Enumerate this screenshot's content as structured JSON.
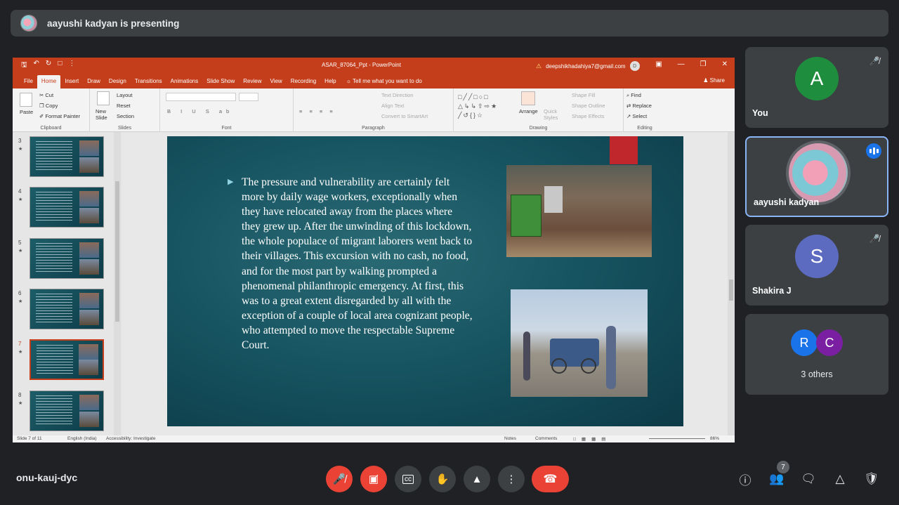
{
  "presenting_bar": {
    "text": "aayushi kadyan is presenting"
  },
  "powerpoint": {
    "window_title": "ASAR_87064_Ppt - PowerPoint",
    "account_email": "deepshikhadahiya7@gmail.com",
    "account_initial": "D",
    "tabs": [
      "File",
      "Home",
      "Insert",
      "Draw",
      "Design",
      "Transitions",
      "Animations",
      "Slide Show",
      "Review",
      "View",
      "Recording",
      "Help"
    ],
    "tell_me": "Tell me what you want to do",
    "share": "Share",
    "ribbon": {
      "clipboard": {
        "paste": "Paste",
        "cut": "Cut",
        "copy": "Copy",
        "format_painter": "Format Painter",
        "label": "Clipboard"
      },
      "slides": {
        "new_slide": "New Slide",
        "layout": "Layout",
        "reset": "Reset",
        "section": "Section",
        "label": "Slides"
      },
      "font": {
        "label": "Font"
      },
      "paragraph": {
        "text_direction": "Text Direction",
        "align_text": "Align Text",
        "convert": "Convert to SmartArt",
        "label": "Paragraph"
      },
      "drawing": {
        "arrange": "Arrange",
        "quick_styles": "Quick Styles",
        "shape_fill": "Shape Fill",
        "shape_outline": "Shape Outline",
        "shape_effects": "Shape Effects",
        "label": "Drawing"
      },
      "editing": {
        "find": "Find",
        "replace": "Replace",
        "select": "Select",
        "label": "Editing"
      }
    },
    "thumbnails": [
      {
        "num": "3",
        "current": false
      },
      {
        "num": "4",
        "current": false
      },
      {
        "num": "5",
        "current": false
      },
      {
        "num": "6",
        "current": false
      },
      {
        "num": "7",
        "current": true
      },
      {
        "num": "8",
        "current": false
      }
    ],
    "slide": {
      "bullet": "The pressure and vulnerability are certainly felt more by daily wage workers, exceptionally when they have relocated away from the places where they grew up. After the unwinding of this lockdown, the whole populace of migrant laborers went back to their villages. This excursion with no cash, no food, and for the most part by walking prompted a phenomenal philanthropic emergency. At first, this was to a great extent disregarded by all with the exception of a couple of local area cognizant people, who attempted to move the respectable Supreme Court."
    },
    "status": {
      "slide_of": "Slide 7 of 11",
      "language": "English (India)",
      "accessibility": "Accessibility: Investigate",
      "notes": "Notes",
      "comments": "Comments",
      "zoom": "86%"
    }
  },
  "participants": [
    {
      "initial": "A",
      "name": "You",
      "color": "#1e8e3e",
      "muted": true
    },
    {
      "name": "aayushi kadyan",
      "speaking": true
    },
    {
      "initial": "S",
      "name": "Shakira J",
      "color": "#5c6bc0",
      "muted": true
    },
    {
      "others": [
        {
          "initial": "R",
          "color": "#1a73e8"
        },
        {
          "initial": "C",
          "color": "#7b1fa2"
        }
      ],
      "label": "3 others"
    }
  ],
  "bottom_bar": {
    "meeting_code": "onu-kauj-dyc",
    "participant_count": "7",
    "icons": [
      "mic-off-icon",
      "camera-off-icon",
      "captions-icon",
      "raise-hand-icon",
      "present-icon",
      "more-icon",
      "hangup-icon",
      "info-icon",
      "people-icon",
      "chat-icon",
      "activities-icon",
      "host-controls-icon"
    ]
  }
}
